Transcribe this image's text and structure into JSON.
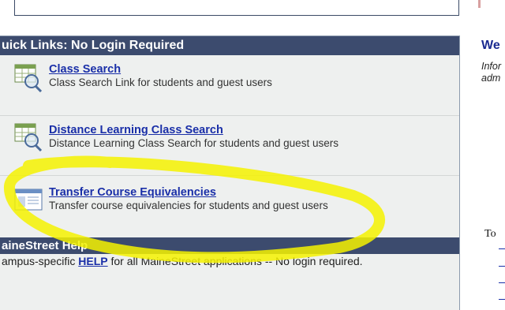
{
  "quick_links": {
    "header": "uick Links: No Login Required",
    "items": [
      {
        "title": "Class Search",
        "desc": "Class Search Link for students and guest users",
        "icon": "magnifier-grid-icon"
      },
      {
        "title": "Distance Learning Class Search",
        "desc": "Distance Learning Class Search for students and guest users",
        "icon": "magnifier-grid-icon"
      },
      {
        "title": "Transfer Course Equivalencies",
        "desc": "Transfer course equivalencies for students and guest users",
        "icon": "document-window-icon"
      }
    ]
  },
  "help": {
    "header": "aineStreet Help",
    "text_before": "ampus-specific ",
    "link": "HELP",
    "text_after": " for all MaineStreet applications -- No login required."
  },
  "right": {
    "heading": "We",
    "info_line1": "Infor",
    "info_line2": "adm",
    "to": "To"
  },
  "highlight_color": "#f5f200"
}
